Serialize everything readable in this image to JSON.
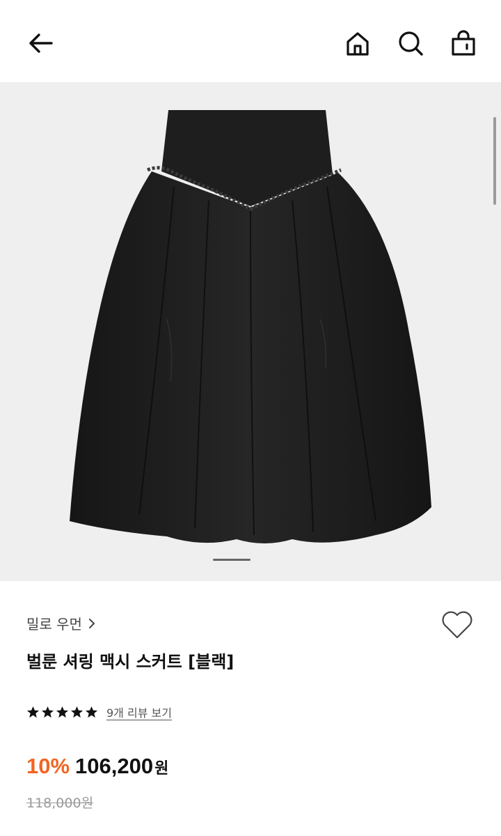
{
  "header": {
    "back_icon": "arrow-left-icon",
    "home_icon": "home-icon",
    "search_icon": "search-icon",
    "bag_icon": "shopping-bag-icon"
  },
  "gallery": {
    "image_description": "black balloon shirring maxi skirt",
    "current_slide": 1
  },
  "product": {
    "brand": "밀로 우먼",
    "title": "벌룬 셔링 맥시 스커트 [블랙]",
    "rating": 5,
    "review_link": "9개 리뷰 보기",
    "discount": "10%",
    "price": "106,200",
    "currency": "원",
    "original_price": "118,000원"
  },
  "colors": {
    "accent": "#f26522",
    "gallery_bg": "#efefef",
    "text": "#111111",
    "muted": "#999999"
  }
}
